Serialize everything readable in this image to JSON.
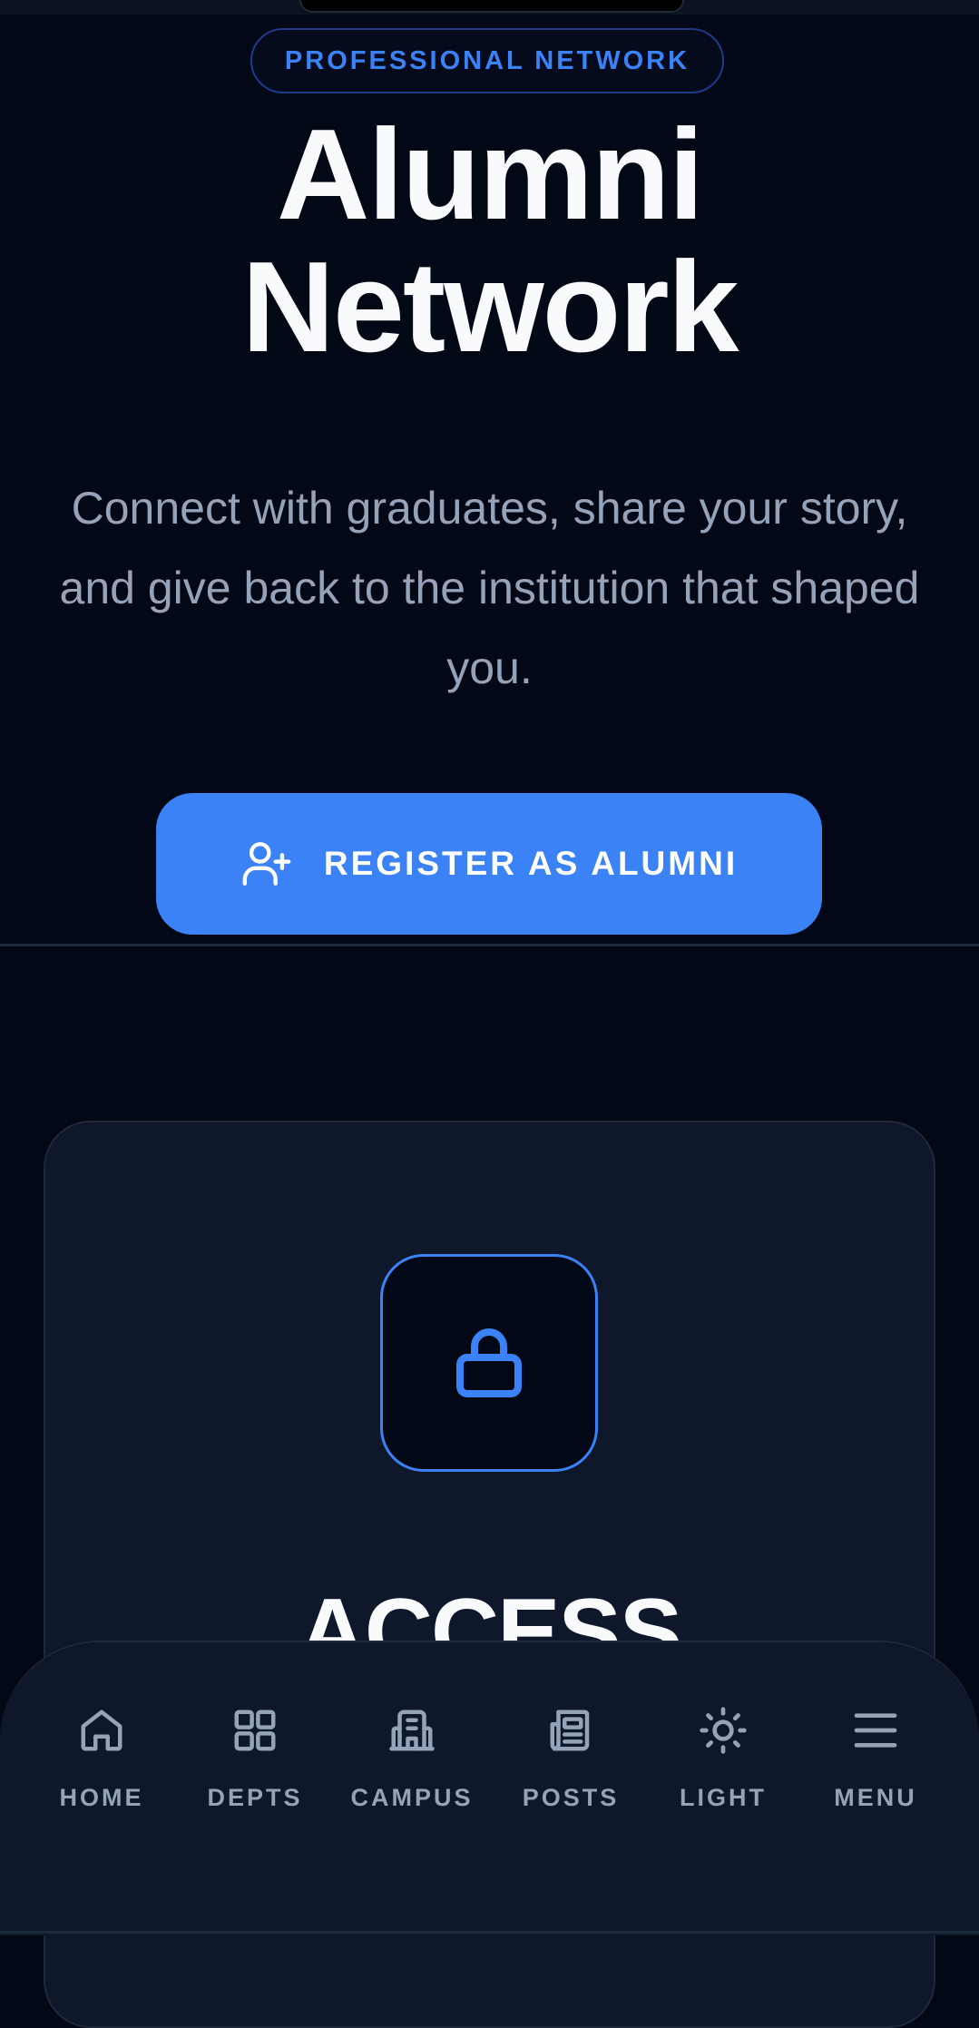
{
  "hero": {
    "badge": "PROFESSIONAL NETWORK",
    "title_line1": "Alumni",
    "title_line2": "Network",
    "description": "Connect with graduates, share your story, and give back to the institution that shaped you.",
    "register_label": "REGISTER AS ALUMNI",
    "register_icon": "user-plus-icon"
  },
  "card": {
    "icon": "lock-icon",
    "heading": "ACCESS"
  },
  "bottom_nav": {
    "items": [
      {
        "label": "HOME",
        "icon": "home-icon"
      },
      {
        "label": "DEPTS",
        "icon": "grid-icon"
      },
      {
        "label": "CAMPUS",
        "icon": "building-icon"
      },
      {
        "label": "POSTS",
        "icon": "newspaper-icon"
      },
      {
        "label": "LIGHT",
        "icon": "sun-icon"
      },
      {
        "label": "MENU",
        "icon": "menu-icon"
      }
    ]
  },
  "colors": {
    "background": "#030817",
    "accent": "#3b82f6",
    "card": "#0f172a",
    "muted_text": "#94a3b8"
  }
}
